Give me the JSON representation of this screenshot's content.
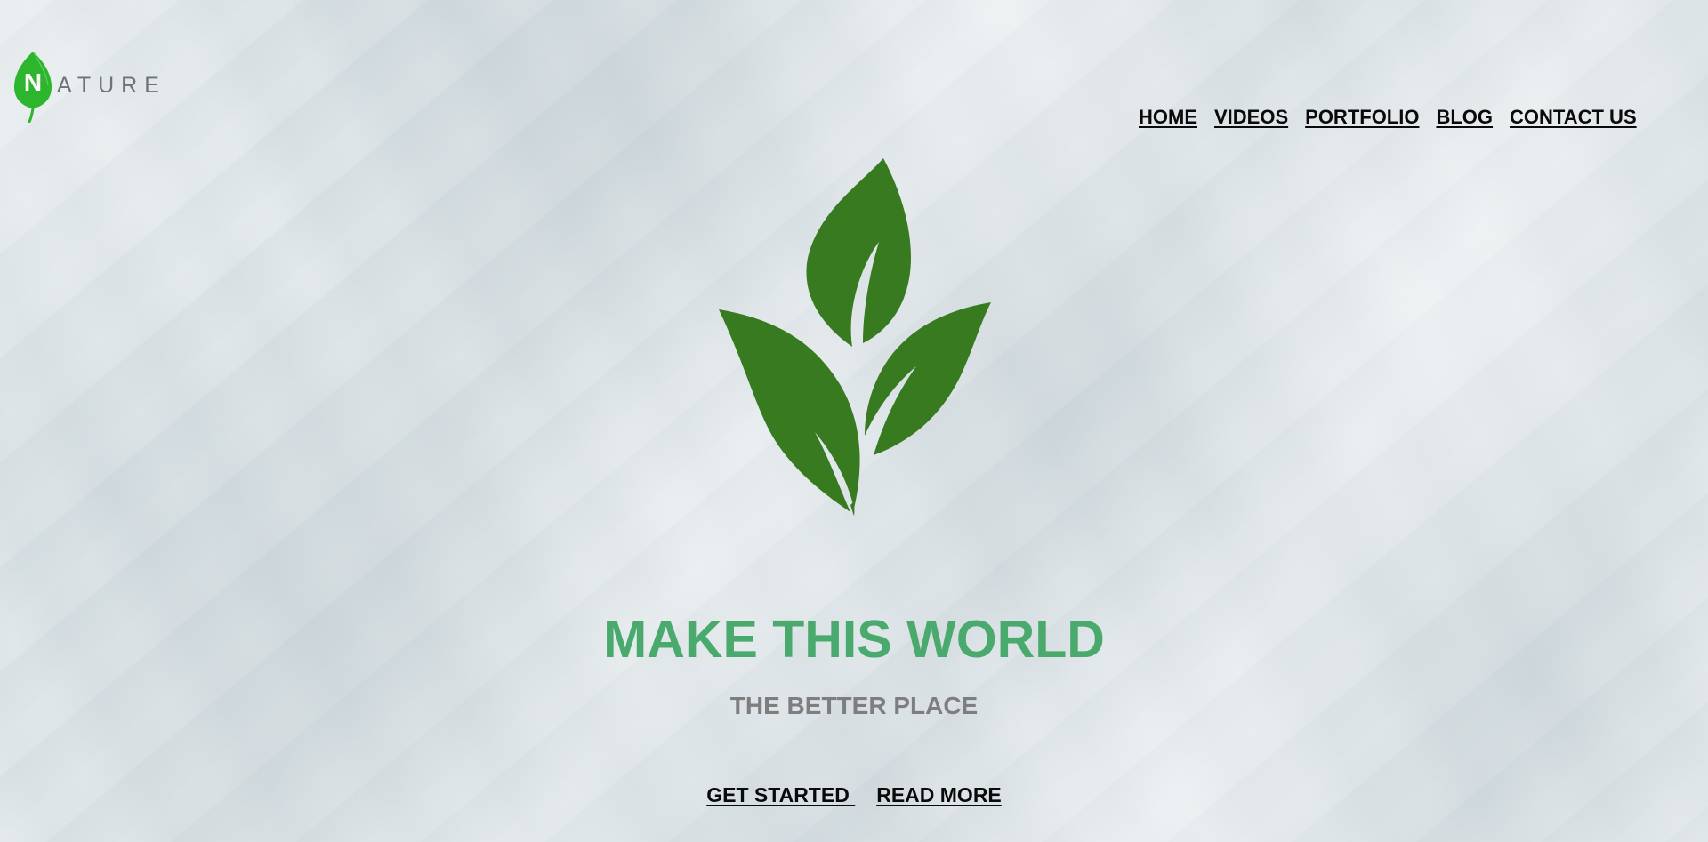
{
  "logo": {
    "first_letter": "N",
    "rest": "ATURE",
    "leaf_color": "#2db52d",
    "icon": "leaf-icon"
  },
  "nav": {
    "items": [
      {
        "label": "HOME"
      },
      {
        "label": "VIDEOS"
      },
      {
        "label": "PORTFOLIO"
      },
      {
        "label": "BLOG"
      },
      {
        "label": "CONTACT US"
      }
    ]
  },
  "hero": {
    "icon": "sprout-icon",
    "plant_color": "#377a20",
    "headline": "MAKE THIS WORLD",
    "headline_color": "#4aa96c",
    "subhead": "THE BETTER PLACE",
    "subhead_color": "#7e7e7e",
    "buttons": {
      "primary": "GET STARTED ",
      "secondary": "READ MORE"
    }
  }
}
